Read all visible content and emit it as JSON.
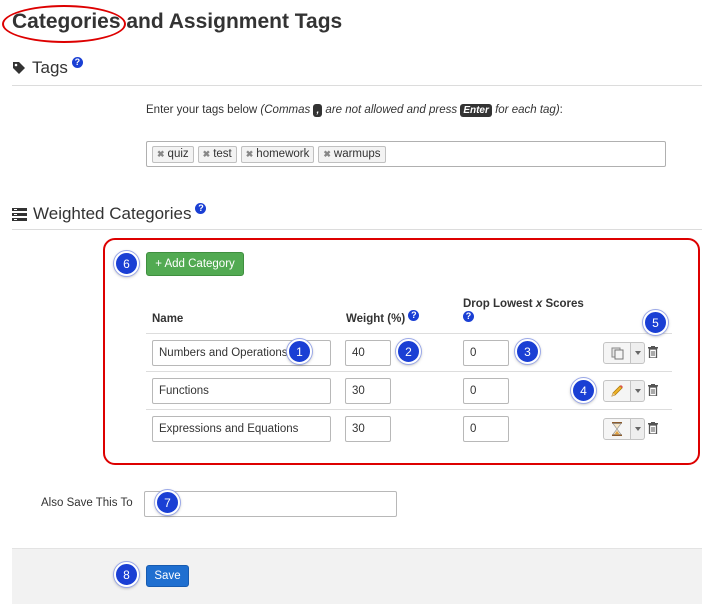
{
  "page": {
    "title": "Categories and Assignment Tags"
  },
  "tags_section": {
    "heading": "Tags",
    "help": "?",
    "instruction_start": "Enter your tags below ",
    "instruction_italic_a": "(Commas ",
    "comma_key": ",",
    "instruction_italic_b": " are not allowed and press ",
    "enter_key": "Enter",
    "instruction_italic_c": " for each tag)",
    "instruction_end": ":",
    "tags": [
      "quiz",
      "test",
      "homework",
      "warmups"
    ],
    "remove_glyph": "✖"
  },
  "categories_section": {
    "heading": "Weighted Categories",
    "help": "?",
    "add_button": "+ Add Category",
    "columns": {
      "name": "Name",
      "weight": "Weight (%)",
      "drop_a": "Drop Lowest ",
      "drop_x": "x",
      "drop_b": " Scores"
    },
    "rows": [
      {
        "name": "Numbers and Operations",
        "weight": "40",
        "drop": "0",
        "icon": "copy-icon"
      },
      {
        "name": "Functions",
        "weight": "30",
        "drop": "0",
        "icon": "pencil-icon"
      },
      {
        "name": "Expressions and Equations",
        "weight": "30",
        "drop": "0",
        "icon": "hourglass-icon"
      }
    ]
  },
  "also_save": {
    "label": "Also Save This To",
    "value": ""
  },
  "footer": {
    "save_button": "Save"
  },
  "callouts": [
    "1",
    "2",
    "3",
    "4",
    "5",
    "6",
    "7",
    "8"
  ],
  "colors": {
    "callout": "#1a3fd4",
    "highlight": "#dd0000",
    "add_button": "#52aa52",
    "save_button": "#1f6fd0"
  }
}
